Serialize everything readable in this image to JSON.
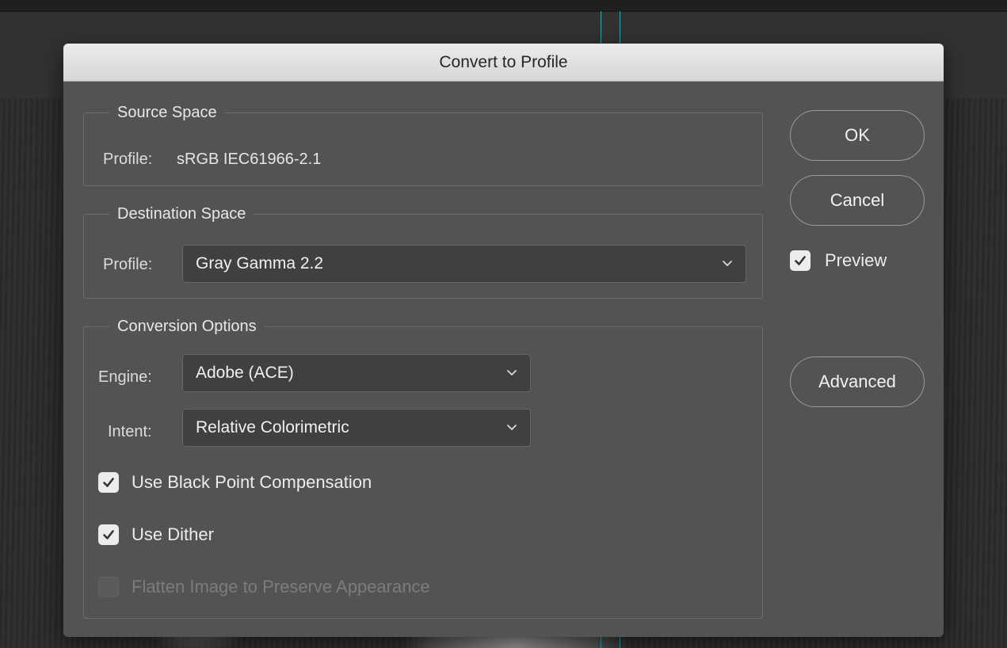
{
  "dialog": {
    "title": "Convert to Profile"
  },
  "source_space": {
    "legend": "Source Space",
    "profile_label": "Profile:",
    "profile_value": "sRGB IEC61966-2.1"
  },
  "destination_space": {
    "legend": "Destination Space",
    "profile_label": "Profile:",
    "profile_selected": "Gray Gamma 2.2"
  },
  "conversion_options": {
    "legend": "Conversion Options",
    "engine_label": "Engine:",
    "engine_selected": "Adobe (ACE)",
    "intent_label": "Intent:",
    "intent_selected": "Relative Colorimetric",
    "checkboxes": [
      {
        "label": "Use Black Point Compensation",
        "checked": true,
        "enabled": true
      },
      {
        "label": "Use Dither",
        "checked": true,
        "enabled": true
      },
      {
        "label": "Flatten Image to Preserve Appearance",
        "checked": false,
        "enabled": false
      }
    ]
  },
  "buttons": {
    "ok": "OK",
    "cancel": "Cancel",
    "advanced": "Advanced"
  },
  "preview": {
    "label": "Preview",
    "checked": true
  },
  "icons": {
    "checkmark": "checkmark-icon",
    "dropdown": "chevron-down-icon"
  },
  "colors": {
    "dialog_bg": "#535353",
    "titlebar_bg": "#dedede",
    "guide_line": "#38b9c9"
  }
}
